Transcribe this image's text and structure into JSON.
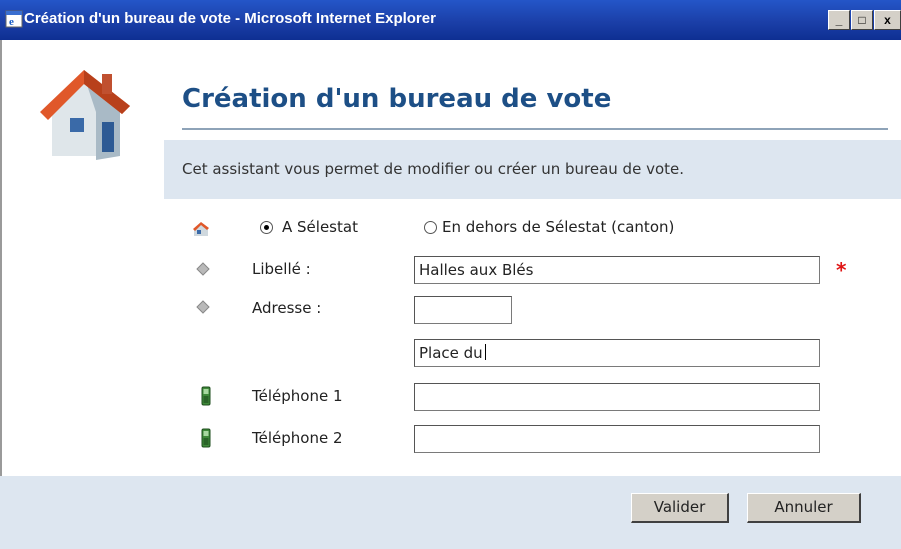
{
  "window": {
    "title": "Création d'un bureau de vote - Microsoft Internet Explorer",
    "minimize": "_",
    "maximize": "□",
    "close": "x"
  },
  "heading": "Création d'un bureau de vote",
  "description": "Cet assistant vous permet de modifier ou créer un bureau de vote.",
  "location": {
    "option1": "A Sélestat",
    "option2": "En dehors de Sélestat (canton)",
    "selected": "A Sélestat"
  },
  "form": {
    "libelle_label": "Libellé :",
    "libelle_value": "Halles aux Blés",
    "adresse_label": "Adresse :",
    "adresse_number": "",
    "adresse_street": "Place du",
    "telephone1_label": "Téléphone 1",
    "telephone1_value": "",
    "telephone2_label": "Téléphone 2",
    "telephone2_value": "",
    "required_marker": "*"
  },
  "buttons": {
    "valider": "Valider",
    "annuler": "Annuler"
  },
  "colors": {
    "titlebar": "#1b3fa8",
    "heading": "#1d4f86",
    "panel": "#dde6f0",
    "required": "#e01515"
  }
}
